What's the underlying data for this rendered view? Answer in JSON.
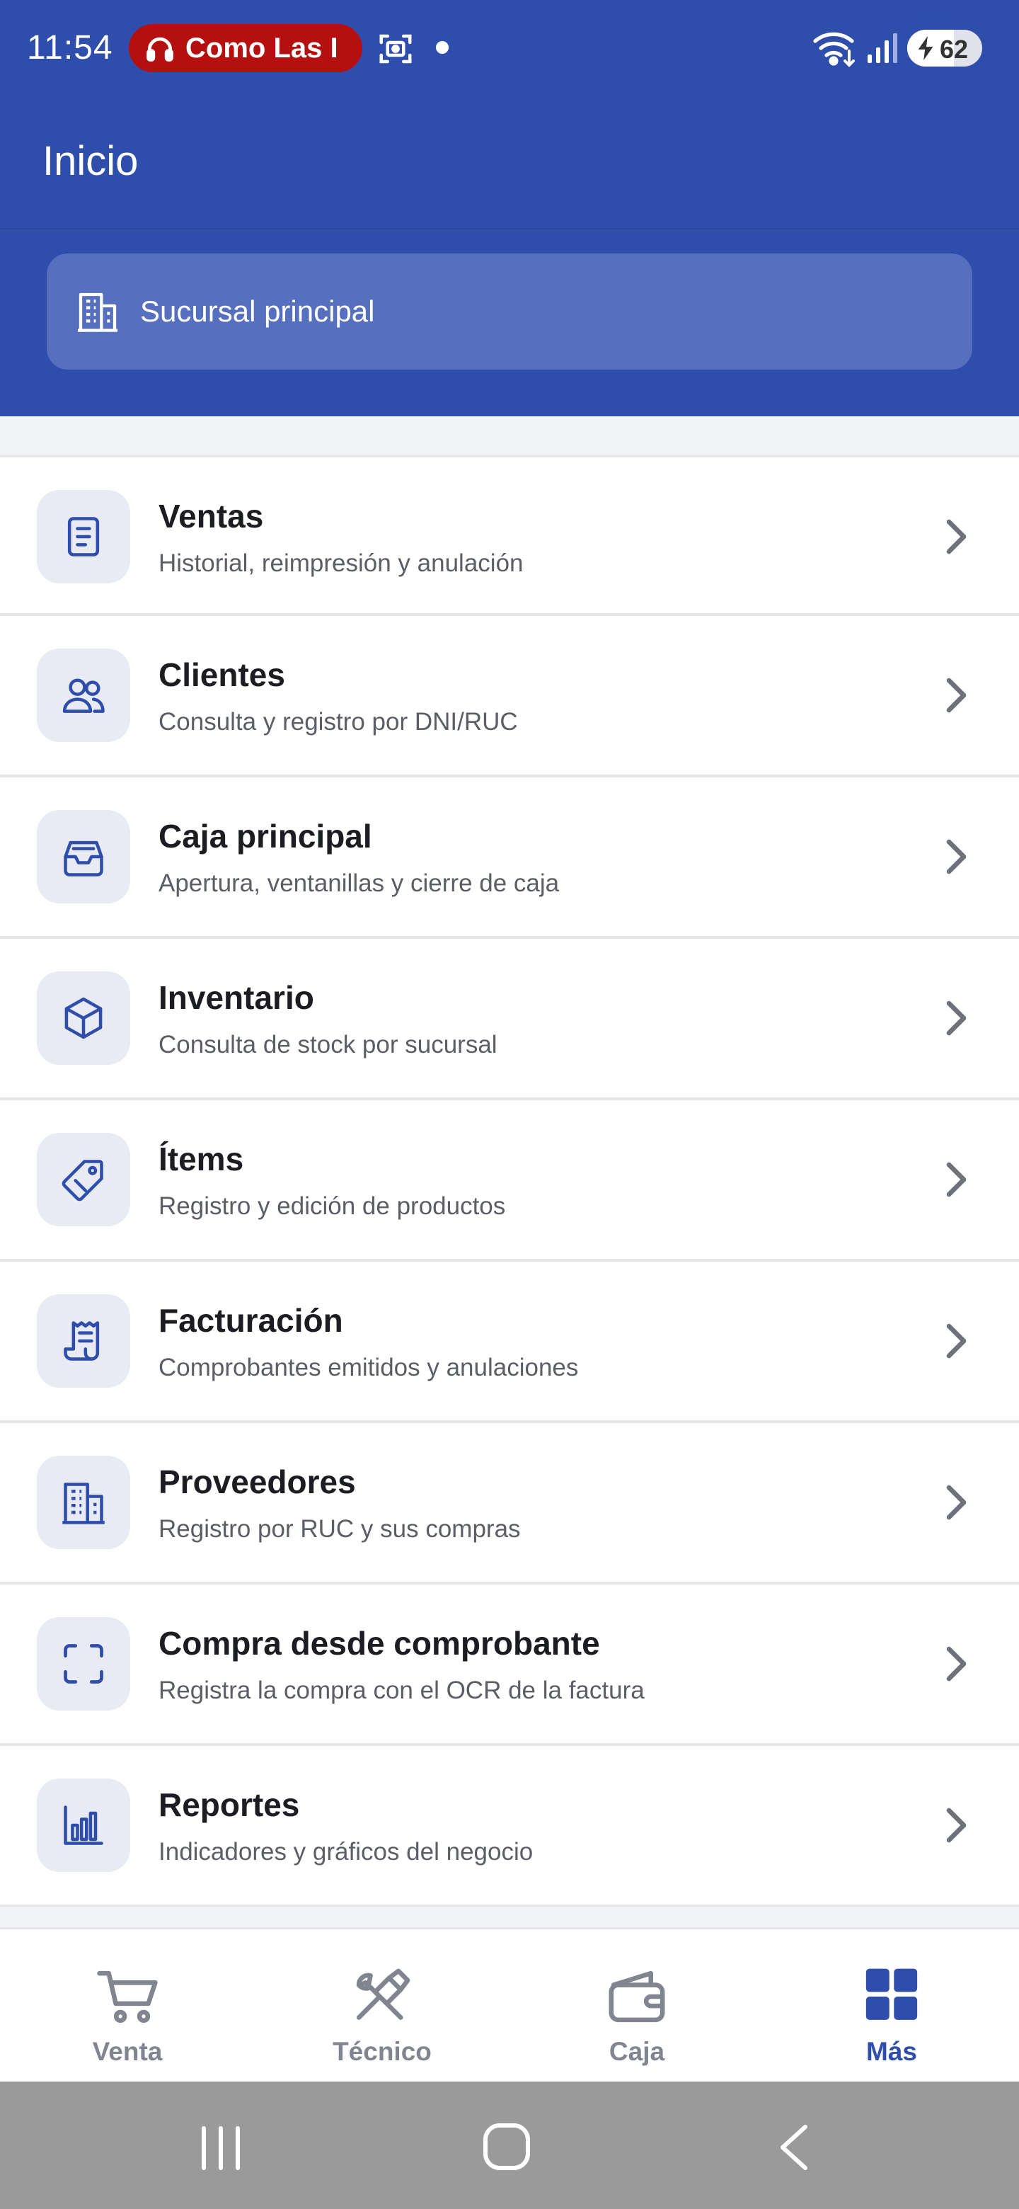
{
  "status_bar": {
    "time": "11:54",
    "media_chip": "Como Las I",
    "battery": "62"
  },
  "app_bar": {
    "title": "Inicio"
  },
  "branch": {
    "name": "Sucursal principal"
  },
  "menu": [
    {
      "icon": "document-icon",
      "title": "Ventas",
      "subtitle": "Historial, reimpresión y anulación"
    },
    {
      "icon": "users-icon",
      "title": "Clientes",
      "subtitle": "Consulta y registro por DNI/RUC"
    },
    {
      "icon": "inbox-tray-icon",
      "title": "Caja principal",
      "subtitle": "Apertura, ventanillas y cierre de caja"
    },
    {
      "icon": "cube-icon",
      "title": "Inventario",
      "subtitle": "Consulta de stock por sucursal"
    },
    {
      "icon": "tag-icon",
      "title": "Ítems",
      "subtitle": "Registro y edición de productos"
    },
    {
      "icon": "receipt-icon",
      "title": "Facturación",
      "subtitle": "Comprobantes emitidos y anulaciones"
    },
    {
      "icon": "building-icon",
      "title": "Proveedores",
      "subtitle": "Registro por RUC y sus compras"
    },
    {
      "icon": "scan-frame-icon",
      "title": "Compra desde comprobante",
      "subtitle": "Registra la compra con el OCR de la factura"
    },
    {
      "icon": "bar-chart-icon",
      "title": "Reportes",
      "subtitle": "Indicadores y gráficos del negocio"
    }
  ],
  "bottom_nav": [
    {
      "icon": "cart-icon",
      "label": "Venta",
      "active": false
    },
    {
      "icon": "tools-icon",
      "label": "Técnico",
      "active": false
    },
    {
      "icon": "wallet-icon",
      "label": "Caja",
      "active": false
    },
    {
      "icon": "grid-icon",
      "label": "Más",
      "active": true
    }
  ],
  "colors": {
    "primary": "#2f4eab",
    "branch_selector": "#5670bf",
    "icon_tile": "#e8ebf4",
    "inactive_nav": "#808590",
    "media_chip": "#b50f0f"
  }
}
